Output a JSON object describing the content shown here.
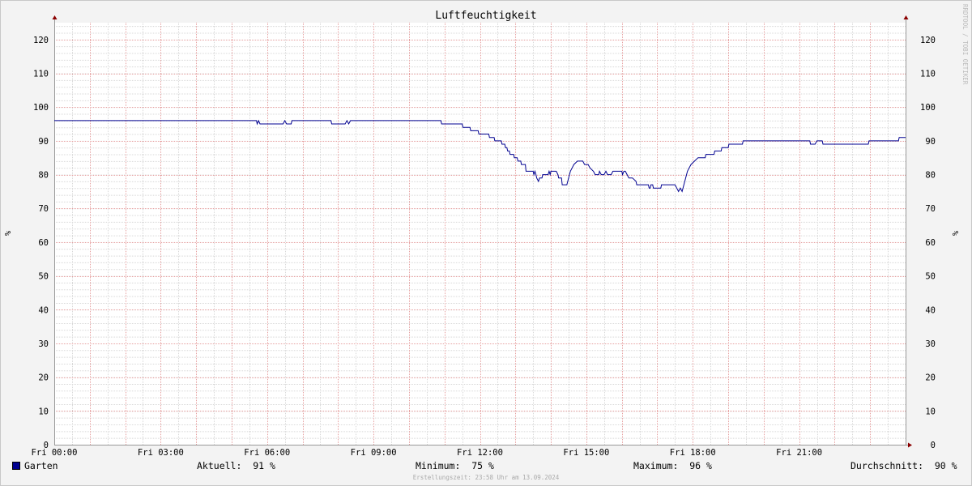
{
  "chart_data": {
    "type": "line",
    "title": "Luftfeuchtigkeit",
    "ylabel": "%",
    "ylabel_right": "%",
    "watermark": "RRDTOOL / TOBI OETIKER",
    "ylim": [
      0,
      125
    ],
    "yticks": [
      0,
      10,
      20,
      30,
      40,
      50,
      60,
      70,
      80,
      90,
      100,
      110,
      120
    ],
    "xlim": [
      0,
      24
    ],
    "xticks": [
      {
        "x": 0,
        "label": "Fri 00:00"
      },
      {
        "x": 3,
        "label": "Fri 03:00"
      },
      {
        "x": 6,
        "label": "Fri 06:00"
      },
      {
        "x": 9,
        "label": "Fri 09:00"
      },
      {
        "x": 12,
        "label": "Fri 12:00"
      },
      {
        "x": 15,
        "label": "Fri 15:00"
      },
      {
        "x": 18,
        "label": "Fri 18:00"
      },
      {
        "x": 21,
        "label": "Fri 21:00"
      }
    ],
    "grid": true,
    "series": [
      {
        "name": "Garten",
        "color": "#000090",
        "points": [
          [
            0,
            96
          ],
          [
            5.7,
            96
          ],
          [
            5.72,
            95
          ],
          [
            5.76,
            96
          ],
          [
            5.8,
            95
          ],
          [
            6.45,
            95
          ],
          [
            6.5,
            96
          ],
          [
            6.55,
            95
          ],
          [
            6.68,
            95
          ],
          [
            6.7,
            96
          ],
          [
            7.8,
            96
          ],
          [
            7.82,
            95
          ],
          [
            8.2,
            95
          ],
          [
            8.25,
            96
          ],
          [
            8.3,
            95
          ],
          [
            8.35,
            96
          ],
          [
            10.9,
            96
          ],
          [
            10.92,
            95
          ],
          [
            11.5,
            95
          ],
          [
            11.52,
            94
          ],
          [
            11.72,
            94
          ],
          [
            11.74,
            93
          ],
          [
            11.95,
            93
          ],
          [
            11.97,
            92
          ],
          [
            12.25,
            92
          ],
          [
            12.27,
            91
          ],
          [
            12.4,
            91
          ],
          [
            12.42,
            90
          ],
          [
            12.6,
            90
          ],
          [
            12.62,
            89
          ],
          [
            12.7,
            89
          ],
          [
            12.72,
            88
          ],
          [
            12.76,
            88
          ],
          [
            12.78,
            87
          ],
          [
            12.83,
            87
          ],
          [
            12.85,
            86
          ],
          [
            12.95,
            86
          ],
          [
            12.97,
            85
          ],
          [
            13.05,
            85
          ],
          [
            13.07,
            84
          ],
          [
            13.15,
            84
          ],
          [
            13.17,
            83
          ],
          [
            13.28,
            83
          ],
          [
            13.3,
            81
          ],
          [
            13.5,
            81
          ],
          [
            13.52,
            80
          ],
          [
            13.55,
            81
          ],
          [
            13.58,
            80
          ],
          [
            13.6,
            79
          ],
          [
            13.65,
            78
          ],
          [
            13.68,
            79
          ],
          [
            13.75,
            79
          ],
          [
            13.77,
            80
          ],
          [
            13.92,
            80
          ],
          [
            13.95,
            81
          ],
          [
            13.98,
            80
          ],
          [
            14.0,
            81
          ],
          [
            14.15,
            81
          ],
          [
            14.2,
            80
          ],
          [
            14.22,
            79
          ],
          [
            14.3,
            79
          ],
          [
            14.32,
            77
          ],
          [
            14.45,
            77
          ],
          [
            14.5,
            79
          ],
          [
            14.55,
            81
          ],
          [
            14.6,
            82
          ],
          [
            14.65,
            83
          ],
          [
            14.75,
            84
          ],
          [
            14.9,
            84
          ],
          [
            14.95,
            83
          ],
          [
            15.05,
            83
          ],
          [
            15.1,
            82
          ],
          [
            15.2,
            81
          ],
          [
            15.25,
            80
          ],
          [
            15.35,
            80
          ],
          [
            15.37,
            81
          ],
          [
            15.42,
            80
          ],
          [
            15.5,
            80
          ],
          [
            15.55,
            81
          ],
          [
            15.6,
            80
          ],
          [
            15.7,
            80
          ],
          [
            15.75,
            81
          ],
          [
            16.0,
            81
          ],
          [
            16.02,
            80
          ],
          [
            16.06,
            81
          ],
          [
            16.1,
            81
          ],
          [
            16.15,
            80
          ],
          [
            16.2,
            79
          ],
          [
            16.3,
            79
          ],
          [
            16.4,
            78
          ],
          [
            16.42,
            77
          ],
          [
            16.75,
            77
          ],
          [
            16.77,
            76
          ],
          [
            16.8,
            76
          ],
          [
            16.82,
            77
          ],
          [
            16.87,
            77
          ],
          [
            16.89,
            76
          ],
          [
            17.1,
            76
          ],
          [
            17.12,
            77
          ],
          [
            17.5,
            77
          ],
          [
            17.55,
            76
          ],
          [
            17.6,
            75
          ],
          [
            17.65,
            76
          ],
          [
            17.7,
            75
          ],
          [
            17.75,
            77
          ],
          [
            17.8,
            79
          ],
          [
            17.85,
            81
          ],
          [
            17.9,
            82
          ],
          [
            17.95,
            83
          ],
          [
            18.05,
            84
          ],
          [
            18.15,
            85
          ],
          [
            18.35,
            85
          ],
          [
            18.37,
            86
          ],
          [
            18.6,
            86
          ],
          [
            18.62,
            87
          ],
          [
            18.8,
            87
          ],
          [
            18.82,
            88
          ],
          [
            19.0,
            88
          ],
          [
            19.02,
            89
          ],
          [
            19.4,
            89
          ],
          [
            19.42,
            90
          ],
          [
            21.3,
            90
          ],
          [
            21.32,
            89
          ],
          [
            21.45,
            89
          ],
          [
            21.5,
            90
          ],
          [
            21.65,
            90
          ],
          [
            21.67,
            89
          ],
          [
            22.95,
            89
          ],
          [
            22.97,
            90
          ],
          [
            23.8,
            90
          ],
          [
            23.82,
            91
          ],
          [
            24,
            91
          ]
        ]
      }
    ]
  },
  "legend": {
    "series_name": "Garten",
    "current": "Aktuell:  91 %",
    "minimum": "Minimum:  75 %",
    "maximum": "Maximum:  96 %",
    "average": "Durchschnitt:  90 %"
  },
  "footer": "Erstellungszeit: 23:58 Uhr am 13.09.2024",
  "colors": {
    "background": "#f3f3f3",
    "canvas": "#ffffff",
    "major_grid": "#e6a0a0",
    "minor_grid": "#d8d8d8",
    "line": "#000090",
    "axis": "#8b0000"
  }
}
